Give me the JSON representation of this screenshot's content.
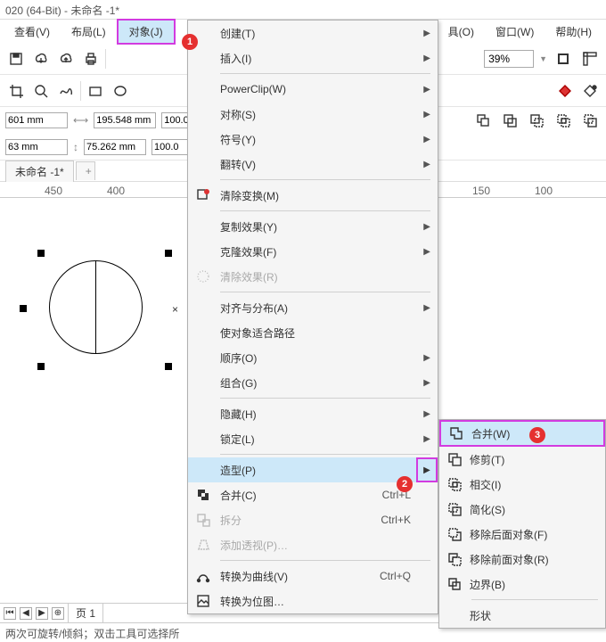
{
  "title": "020 (64-Bit) - 未命名 -1*",
  "menubar": {
    "view": "查看(V)",
    "layout": "布局(L)",
    "object": "对象(J)",
    "tools": "具(O)",
    "window": "窗口(W)",
    "help": "帮助(H)"
  },
  "zoom": "39%",
  "props": {
    "x": "601 mm",
    "y": "63 mm",
    "w": "195.548 mm",
    "h": "75.262 mm",
    "sx": "100.0",
    "sy": "100.0"
  },
  "tab_name": "未命名 -1*",
  "ruler": {
    "l1": "450",
    "l2": "400",
    "r1": "150",
    "r2": "100"
  },
  "pages": {
    "label": "页 1"
  },
  "status": "两次可旋转/倾斜；双击工具可选择所",
  "menu": {
    "create": "创建(T)",
    "insert": "插入(I)",
    "powerclip": "PowerClip(W)",
    "symmetry": "对称(S)",
    "symbol": "符号(Y)",
    "flip": "翻转(V)",
    "clear_transform": "清除变换(M)",
    "copy_effect": "复制效果(Y)",
    "clone_effect": "克隆效果(F)",
    "clear_effect": "清除效果(R)",
    "align": "对齐与分布(A)",
    "fit_path": "使对象适合路径",
    "order": "顺序(O)",
    "group": "组合(G)",
    "hide": "隐藏(H)",
    "lock": "锁定(L)",
    "shaping": "造型(P)",
    "combine": "合并(C)",
    "combine_sc": "Ctrl+L",
    "break": "拆分",
    "break_sc": "Ctrl+K",
    "perspective": "添加透视(P)…",
    "to_curve": "转换为曲线(V)",
    "to_curve_sc": "Ctrl+Q",
    "to_bitmap": "转换为位图…"
  },
  "submenu": {
    "weld": "合并(W)",
    "trim": "修剪(T)",
    "intersect": "相交(I)",
    "simplify": "简化(S)",
    "front_minus": "移除后面对象(F)",
    "back_minus": "移除前面对象(R)",
    "boundary": "边界(B)",
    "shape": "形状"
  },
  "badges": {
    "b1": "1",
    "b2": "2",
    "b3": "3"
  }
}
